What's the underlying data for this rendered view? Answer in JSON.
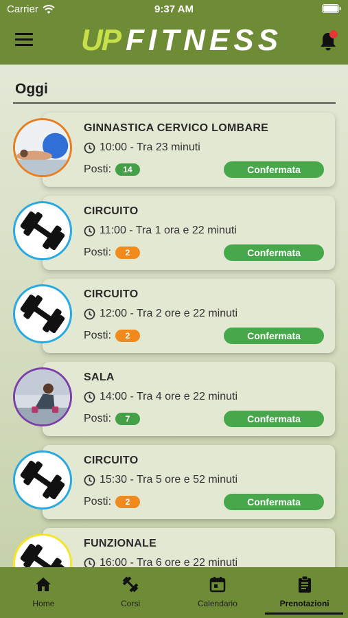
{
  "status_bar": {
    "carrier": "Carrier",
    "time": "9:37 AM"
  },
  "header": {
    "logo_up": "UP",
    "logo_fit": "FITNESS"
  },
  "section": {
    "title": "Oggi"
  },
  "bookings": [
    {
      "title": "GINNASTICA CERVICO LOMBARE",
      "time": "10:00 - Tra 23 minuti",
      "posti_label": "Posti:",
      "posti": "14",
      "badge_color": "#43a047",
      "status": "Confermata",
      "avatar": "photo-floor"
    },
    {
      "title": "CIRCUITO",
      "time": "11:00 - Tra 1 ora e 22 minuti",
      "posti_label": "Posti:",
      "posti": "2",
      "badge_color": "#f08a1c",
      "status": "Confermata",
      "avatar": "dumbbell"
    },
    {
      "title": "CIRCUITO",
      "time": "12:00 - Tra 2 ore e 22 minuti",
      "posti_label": "Posti:",
      "posti": "2",
      "badge_color": "#f08a1c",
      "status": "Confermata",
      "avatar": "dumbbell"
    },
    {
      "title": "SALA",
      "time": "14:00 - Tra 4 ore e 22 minuti",
      "posti_label": "Posti:",
      "posti": "7",
      "badge_color": "#43a047",
      "status": "Confermata",
      "avatar": "photo-gym"
    },
    {
      "title": "CIRCUITO",
      "time": "15:30 - Tra 5 ore e 52 minuti",
      "posti_label": "Posti:",
      "posti": "2",
      "badge_color": "#f08a1c",
      "status": "Confermata",
      "avatar": "dumbbell"
    },
    {
      "title": "FUNZIONALE",
      "time": "16:00 - Tra 6 ore e 22 minuti",
      "posti_label": "",
      "posti": "",
      "status": "",
      "avatar": "dumbbell"
    }
  ],
  "tabbar": {
    "items": [
      {
        "label": "Home",
        "icon": "home-icon"
      },
      {
        "label": "Corsi",
        "icon": "dumbbell-icon"
      },
      {
        "label": "Calendario",
        "icon": "calendar-icon"
      },
      {
        "label": "Prenotazioni",
        "icon": "clipboard-icon",
        "active": true
      }
    ]
  },
  "colors": {
    "header_green": "#6e8b35",
    "confirm_green": "#47a84b",
    "logo_lime": "#c7e04a",
    "notification_dot": "#e53935"
  }
}
